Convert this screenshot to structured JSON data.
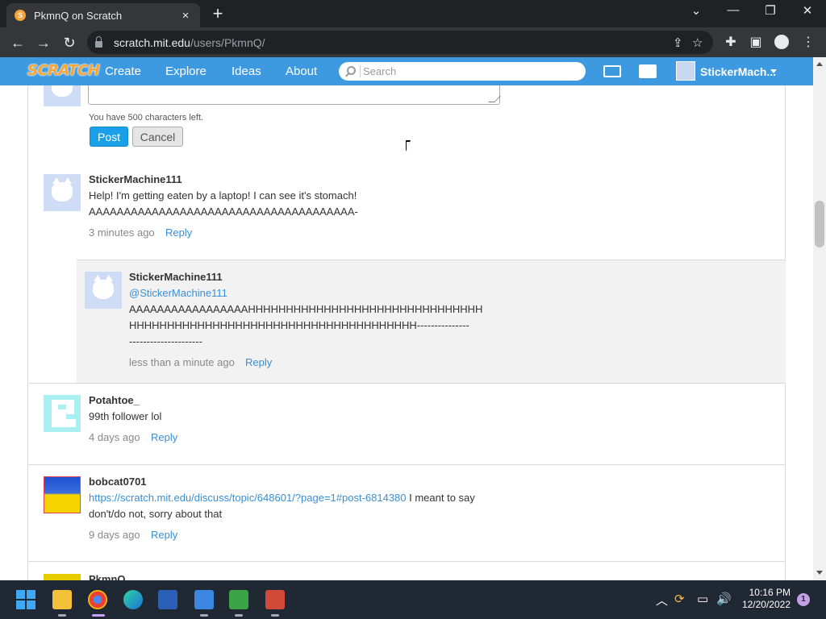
{
  "browser": {
    "tab_title": "PkmnQ on Scratch",
    "tab_favicon": "S",
    "close_tab": "×",
    "new_tab": "+",
    "url_host": "scratch.mit.edu",
    "url_path": "/users/PkmnQ/",
    "win_minimize": "—",
    "win_restore": "❐",
    "win_close": "✕",
    "tab_search": "⌄",
    "back": "←",
    "forward": "→",
    "reload": "↻",
    "share": "⇪",
    "bookmark": "☆",
    "extensions": "✚",
    "sidepanel": "▣",
    "menu": "⋮"
  },
  "nav": {
    "logo": "SCRATCH",
    "links": [
      "Create",
      "Explore",
      "Ideas",
      "About"
    ],
    "search_placeholder": "Search",
    "username": "StickerMach..."
  },
  "composer": {
    "chars_left": "You have 500 characters left.",
    "post_label": "Post",
    "cancel_label": "Cancel"
  },
  "comments": [
    {
      "author": "StickerMachine111",
      "text_line1": "Help! I'm getting eaten by a laptop! I can see it's stomach!",
      "text_line2": "AAAAAAAAAAAAAAAAAAAAAAAAAAAAAAAAAAAAAA-",
      "time": "3 minutes ago",
      "reply_label": "Reply"
    },
    {
      "author": "StickerMachine111",
      "mention": "@StickerMachine111",
      "text_line1": "AAAAAAAAAAAAAAAAAHHHHHHHHHHHHHHHHHHHHHHHHHHHHHHH",
      "text_line2": "HHHHHHHHHHHHHHHHHHHHHHHHHHHHHHHHHHHHHH---------------",
      "text_line3": "---------------------",
      "time": "less than a minute ago",
      "reply_label": "Reply"
    },
    {
      "author": "Potahtoe_",
      "text_line1": "99th follower lol",
      "time": "4 days ago",
      "reply_label": "Reply"
    },
    {
      "author": "bobcat0701",
      "link": "https://scratch.mit.edu/discuss/topic/648601/?page=1#post-6814380",
      "text_after_link": " I meant to say",
      "text_line2": "don't/do not, sorry about that",
      "time": "9 days ago",
      "reply_label": "Reply"
    },
    {
      "author": "PkmnQ"
    }
  ],
  "taskbar": {
    "time": "10:16 PM",
    "date": "12/20/2022",
    "notifications": "1",
    "tray_chevron": "︿",
    "tray_sound": "🔊",
    "tray_network": "▭"
  },
  "colors": {
    "scratch_blue": "#3e9ae0",
    "link_blue": "#3a8fd4",
    "post_button": "#1aa0e8"
  }
}
